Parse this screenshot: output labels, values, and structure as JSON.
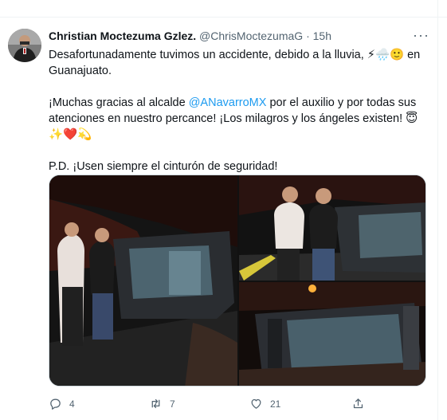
{
  "tweet": {
    "author_name": "Christian Moctezuma Gzlez.",
    "handle": "@ChrisMoctezumaG",
    "separator": "·",
    "time": "15h",
    "more": "···",
    "line1": "Desafortunadamente tuvimos un accidente, debido a la lluvia, ⚡🌧️🙂 en Guanajuato.",
    "line2_start": "¡Muchas gracias al alcalde ",
    "mention": "@ANavarroMX",
    "line2_end": " por el auxilio y por todas sus atenciones en nuestro percance! ¡Los milagros y los ángeles existen! 😇✨❤️💫",
    "line3": "P.D. ¡Usen siempre el cinturón de seguridad!"
  },
  "actions": {
    "reply_count": "4",
    "retweet_count": "7",
    "like_count": "21"
  },
  "icons": [
    "avatar",
    "more-icon",
    "reply-icon",
    "retweet-icon",
    "like-icon",
    "share-icon"
  ],
  "colors": {
    "accent": "#1d9bf0",
    "secondary_text": "#536471",
    "border": "#cfd9de"
  }
}
